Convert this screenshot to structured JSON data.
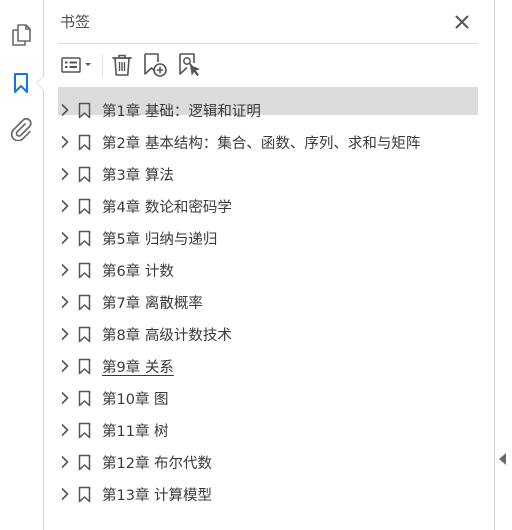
{
  "panel": {
    "title": "书签",
    "close_icon": "close-icon"
  },
  "rail": {
    "items": [
      {
        "name": "page-thumbnails",
        "icon": "pages-icon"
      },
      {
        "name": "bookmarks",
        "icon": "bookmark-icon",
        "active": true
      },
      {
        "name": "attachments",
        "icon": "paperclip-icon"
      }
    ]
  },
  "toolbar": {
    "options_icon": "options-menu-icon",
    "delete_icon": "trash-icon",
    "new_bookmark_icon": "new-bookmark-icon",
    "find_bookmark_icon": "find-bookmark-icon"
  },
  "bookmarks": [
    {
      "label": "第1章  基础：逻辑和证明"
    },
    {
      "label": "第2章  基本结构：集合、函数、序列、求和与矩阵"
    },
    {
      "label": "第3章  算法"
    },
    {
      "label": "第4章  数论和密码学"
    },
    {
      "label": "第5章  归纳与递归"
    },
    {
      "label": "第6章  计数"
    },
    {
      "label": "第7章  离散概率"
    },
    {
      "label": "第8章  高级计数技术"
    },
    {
      "label": "第9章  关系",
      "hovered": true
    },
    {
      "label": "第10章  图"
    },
    {
      "label": "第11章  树"
    },
    {
      "label": "第12章  布尔代数"
    },
    {
      "label": "第13章  计算模型"
    }
  ],
  "colors": {
    "accent": "#1473e6",
    "icon": "#6a6a6a",
    "text": "#3a3a3a"
  }
}
